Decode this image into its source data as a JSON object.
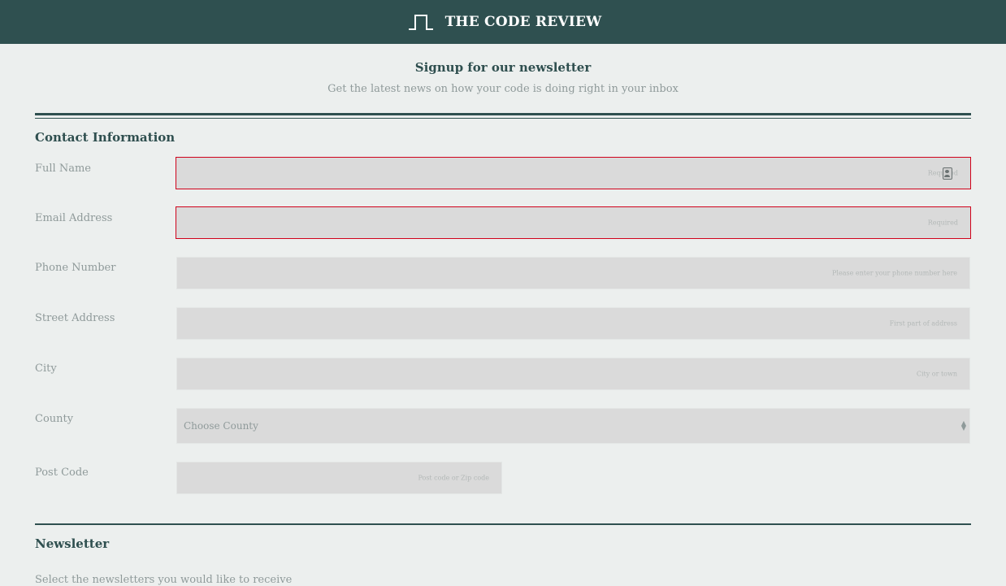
{
  "header": {
    "brand_icon": "pulse-wave-logo-icon",
    "brand_title": "THE CODE REVIEW",
    "bg_color": "#2f5050"
  },
  "intro": {
    "title": "Signup for our newsletter",
    "subtitle": "Get the latest news on how your code is doing right in your inbox"
  },
  "contact": {
    "section_title": "Contact Information",
    "fields": [
      {
        "label": "Full Name",
        "placeholder": "Required",
        "invalid": true
      },
      {
        "label": "Email Address",
        "placeholder": "Required",
        "invalid": true
      },
      {
        "label": "Phone Number",
        "placeholder": "Please enter your phone number here",
        "invalid": false
      },
      {
        "label": "Street Address",
        "placeholder": "First part of address",
        "invalid": false
      },
      {
        "label": "City",
        "placeholder": "City or town",
        "invalid": false
      }
    ],
    "county": {
      "label": "County",
      "selected": "Choose County"
    },
    "postcode": {
      "label": "Post Code",
      "placeholder": "Post code or Zip code"
    }
  },
  "newsletter": {
    "section_title": "Newsletter",
    "description": "Select the newsletters you would like to receive"
  },
  "colors": {
    "invalid_border": "#d0021b",
    "rule": "#2f5050",
    "page_bg": "#ecefee"
  }
}
